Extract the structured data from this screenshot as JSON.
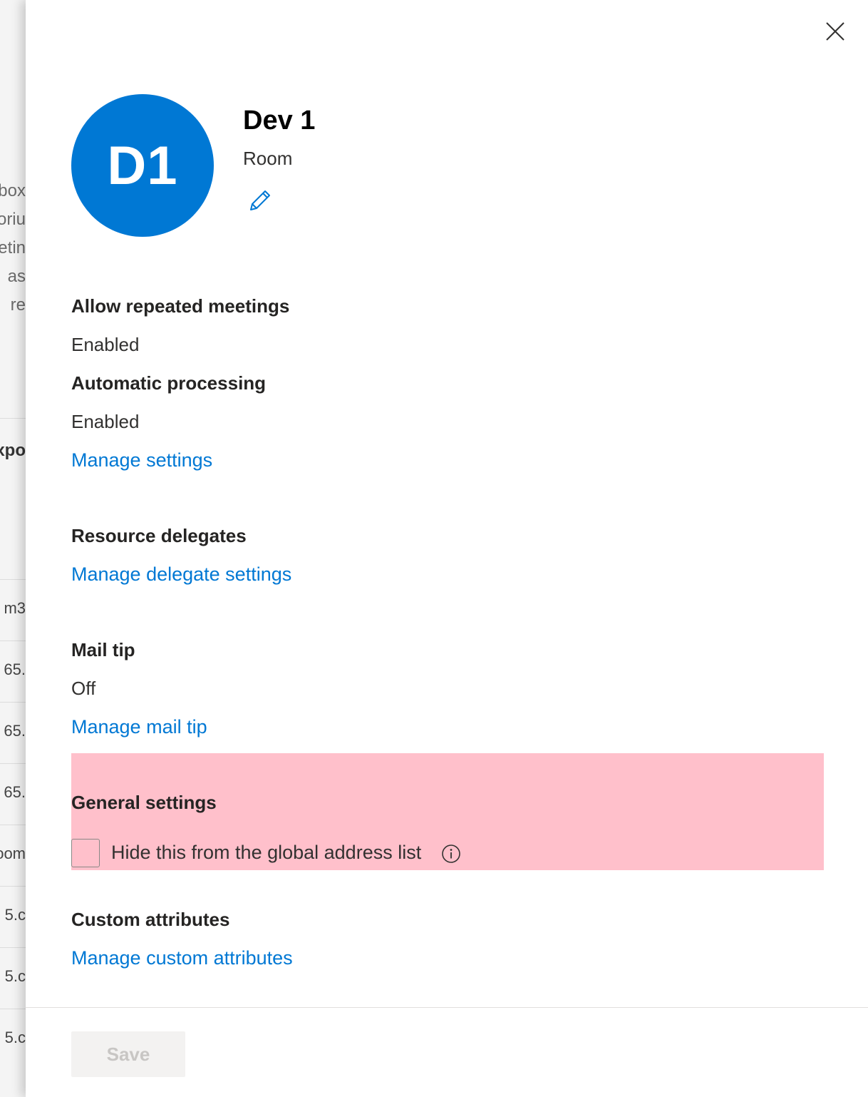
{
  "background": {
    "fragments": [
      "box",
      "oriu",
      "etin",
      "as",
      "re",
      "xpo",
      "m3",
      "65.",
      "65.",
      "65.",
      "oom",
      "5.c",
      "5.c",
      "5.c"
    ]
  },
  "panel": {
    "close_icon": "close-icon",
    "avatar_initials": "D1",
    "avatar_color": "#0078d4",
    "name": "Dev 1",
    "type": "Room",
    "edit_icon": "pencil-icon"
  },
  "sections": {
    "repeated_meetings": {
      "title": "Allow repeated meetings",
      "value": "Enabled"
    },
    "automatic_processing": {
      "title": "Automatic processing",
      "value": "Enabled",
      "link": "Manage settings"
    },
    "resource_delegates": {
      "title": "Resource delegates",
      "link": "Manage delegate settings"
    },
    "mail_tip": {
      "title": "Mail tip",
      "value": "Off",
      "link": "Manage mail tip"
    },
    "general_settings": {
      "title": "General settings",
      "hide_gal_label": "Hide this from the global address list",
      "hide_gal_checked": false,
      "info_icon": "info-icon",
      "highlight_color": "#ffc0cb"
    },
    "custom_attributes": {
      "title": "Custom attributes",
      "link": "Manage custom attributes"
    }
  },
  "footer": {
    "save_label": "Save",
    "save_enabled": false
  },
  "colors": {
    "link": "#0078d4",
    "accent": "#0078d4"
  }
}
